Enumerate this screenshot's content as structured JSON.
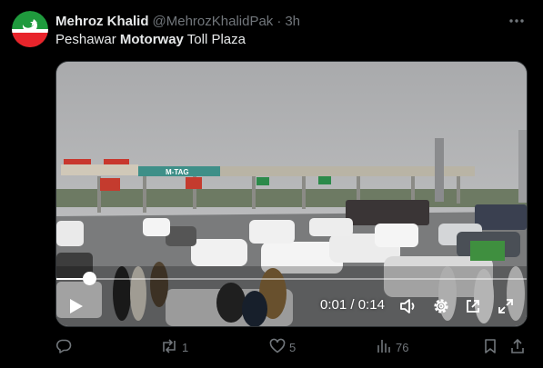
{
  "tweet": {
    "author_name": "Mehroz Khalid",
    "handle": "@MehrozKhalidPak",
    "separator": "·",
    "time": "3h",
    "text_before": "Peshawar ",
    "text_bold": "Motorway",
    "text_after": " Toll Plaza"
  },
  "video": {
    "current_time": "0:01",
    "time_separator": "/",
    "duration": "0:14",
    "progress_fraction": 0.07,
    "scene_signs": [
      "M-TAG"
    ]
  },
  "actions": {
    "reply_count": "",
    "repost_count": "1",
    "like_count": "5",
    "views_count": "76"
  },
  "icons": [
    "more-options-icon",
    "play-icon",
    "volume-icon",
    "settings-icon",
    "pop-out-icon",
    "fullscreen-icon",
    "reply-icon",
    "repost-icon",
    "like-icon",
    "views-icon",
    "bookmark-icon",
    "share-icon"
  ],
  "colors": {
    "background": "#000000",
    "text": "#e7e9ea",
    "muted": "#71767b",
    "avatar_red": "#e8242b",
    "avatar_green": "#1f9a3d"
  }
}
